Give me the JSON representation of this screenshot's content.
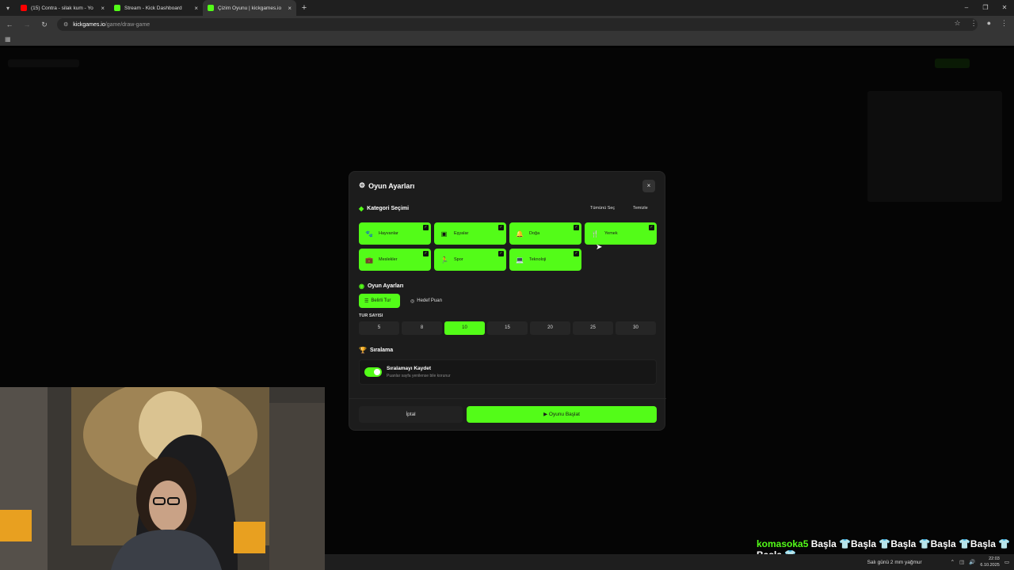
{
  "browser": {
    "tabs": [
      {
        "title": "(15) Contra - silak kum - Yo",
        "favicon_color": "#ff0000",
        "active": false
      },
      {
        "title": "Stream - Kick Dashboard",
        "favicon_color": "#53fc18",
        "active": false
      },
      {
        "title": "Çizim Oyunu | kickgames.io",
        "favicon_color": "#53fc18",
        "active": true
      }
    ],
    "new_tab": "+",
    "url_host": "kickgames.io",
    "url_path": "/game/draw-game"
  },
  "modal": {
    "title": "Oyun Ayarları",
    "close": "×",
    "category_section": "Kategori Seçimi",
    "select_all": "Tümünü Seç",
    "clear": "Temizle",
    "categories": [
      {
        "label": "Hayvanlar",
        "icon": "paw-icon",
        "glyph": "🐾",
        "checked": true
      },
      {
        "label": "Eşyalar",
        "icon": "box-icon",
        "glyph": "▣",
        "checked": true
      },
      {
        "label": "Doğa",
        "icon": "bell-icon",
        "glyph": "🔔",
        "checked": true
      },
      {
        "label": "Yemek",
        "icon": "utensils-icon",
        "glyph": "🍴",
        "checked": true
      },
      {
        "label": "Meslekler",
        "icon": "briefcase-icon",
        "glyph": "💼",
        "checked": true
      },
      {
        "label": "Spor",
        "icon": "running-icon",
        "glyph": "🏃",
        "checked": true
      },
      {
        "label": "Teknoloji",
        "icon": "laptop-icon",
        "glyph": "💻",
        "checked": true
      }
    ],
    "game_section": "Oyun Ayarları",
    "modes": [
      {
        "label": "Belirli Tur",
        "icon": "list-icon",
        "active": true
      },
      {
        "label": "Hedef Puan",
        "icon": "target-icon",
        "active": false
      }
    ],
    "round_label": "TUR SAYISI",
    "rounds": [
      "5",
      "8",
      "10",
      "15",
      "20",
      "25",
      "30"
    ],
    "selected_round": "10",
    "ranking_section": "Sıralama",
    "ranking_title": "Sıralamayı Kaydet",
    "ranking_subtitle": "Puanlar sayfa yenilense bile korunur",
    "ranking_enabled": true,
    "cancel": "İptal",
    "start": "Oyunu Başlat"
  },
  "chat": {
    "user": "komasoka5",
    "message": "Başla 👕Başla 👕Başla 👕Başla 👕Başla 👕Başla 👕"
  },
  "taskbar": {
    "weather": "Salı günü 2 mm yağmur",
    "time": "22:03",
    "date": "6.10.2025"
  },
  "colors": {
    "accent": "#53fc18",
    "modal_bg": "#1c1c1c"
  }
}
